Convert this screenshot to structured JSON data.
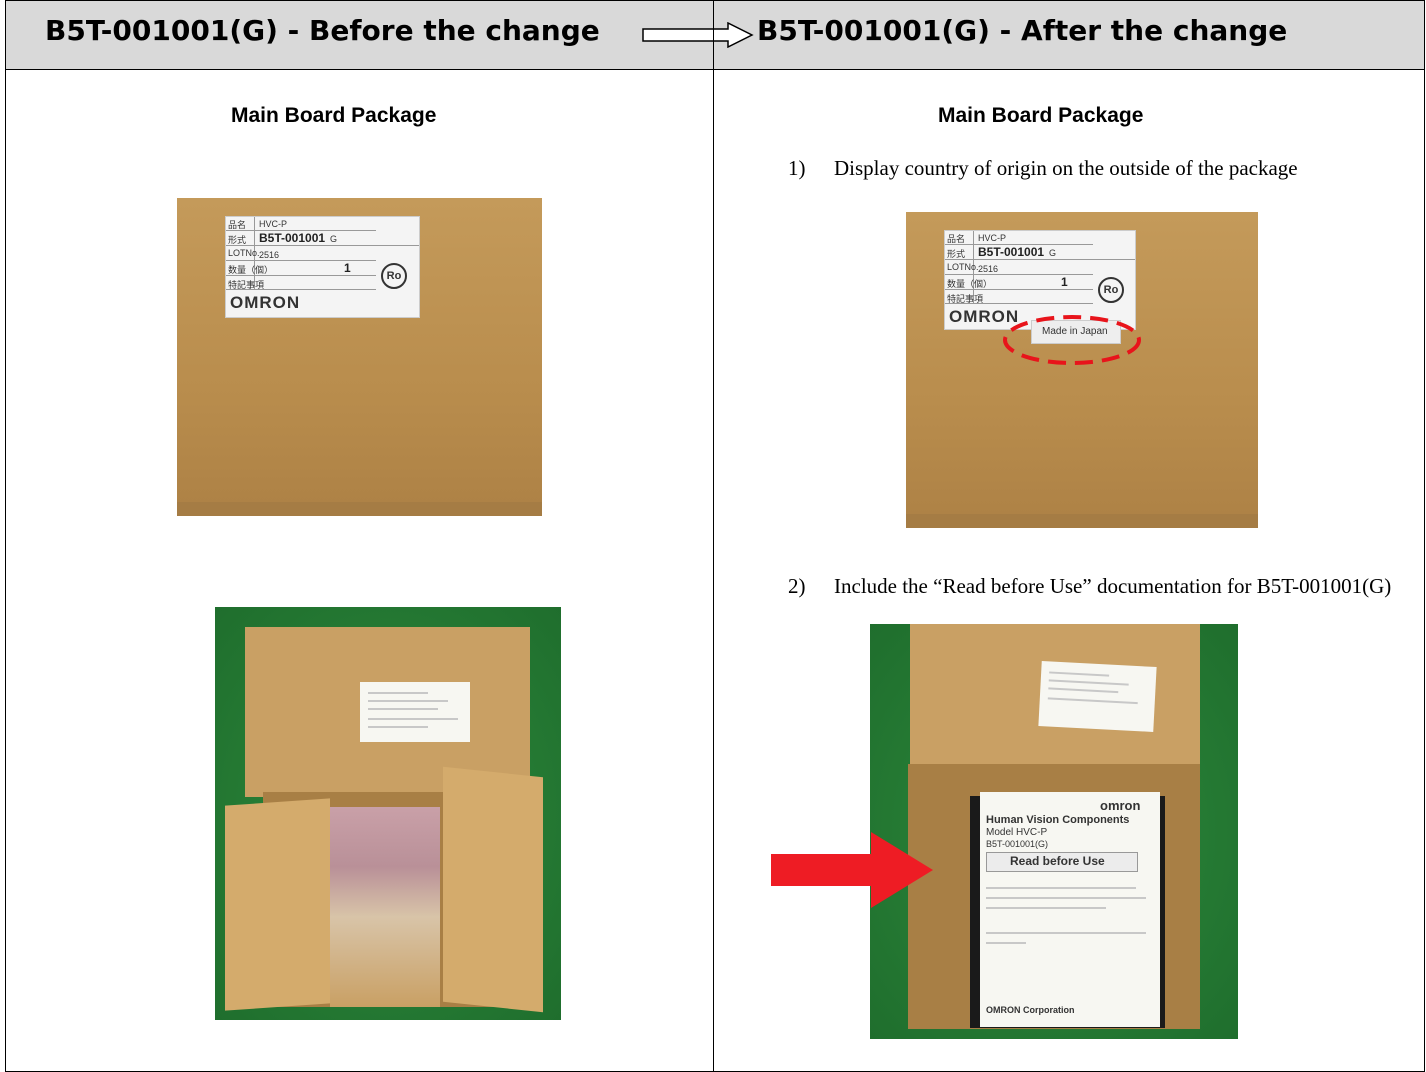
{
  "header": {
    "left_title": "B5T-001001(G) - Before the change",
    "right_title": "B5T-001001(G) - After the change"
  },
  "left": {
    "section_title": "Main Board Package"
  },
  "right": {
    "section_title": "Main Board Package",
    "note1_num": "1)",
    "note1_text": "Display country of origin on the outside of the package",
    "note2_num": "2)",
    "note2_text": "Include the “Read before Use” documentation for B5T-001001(G)"
  },
  "label": {
    "field1": "品名",
    "field1_value": "HVC-P",
    "field2": "形式",
    "field2_value": "B5T-001001",
    "field2_suffix": "G",
    "field3": "LOTNo.",
    "field3_value": "2516",
    "field4": "数量（個）",
    "field4_value": "1",
    "field5": "特記事項",
    "brand": "OMRON",
    "ro_mark": "Ro",
    "made_in": "Made in Japan"
  },
  "leaflet": {
    "brand": "omron",
    "line1": "Human Vision Components",
    "line2": "Model HVC-P",
    "line3": "B5T-001001(G)",
    "heading": "Read before Use",
    "corp": "OMRON Corporation"
  },
  "colors": {
    "header_bg": "#d9d9d9",
    "annotation_red": "#e8141b",
    "arrow_red": "#ee1c24"
  }
}
